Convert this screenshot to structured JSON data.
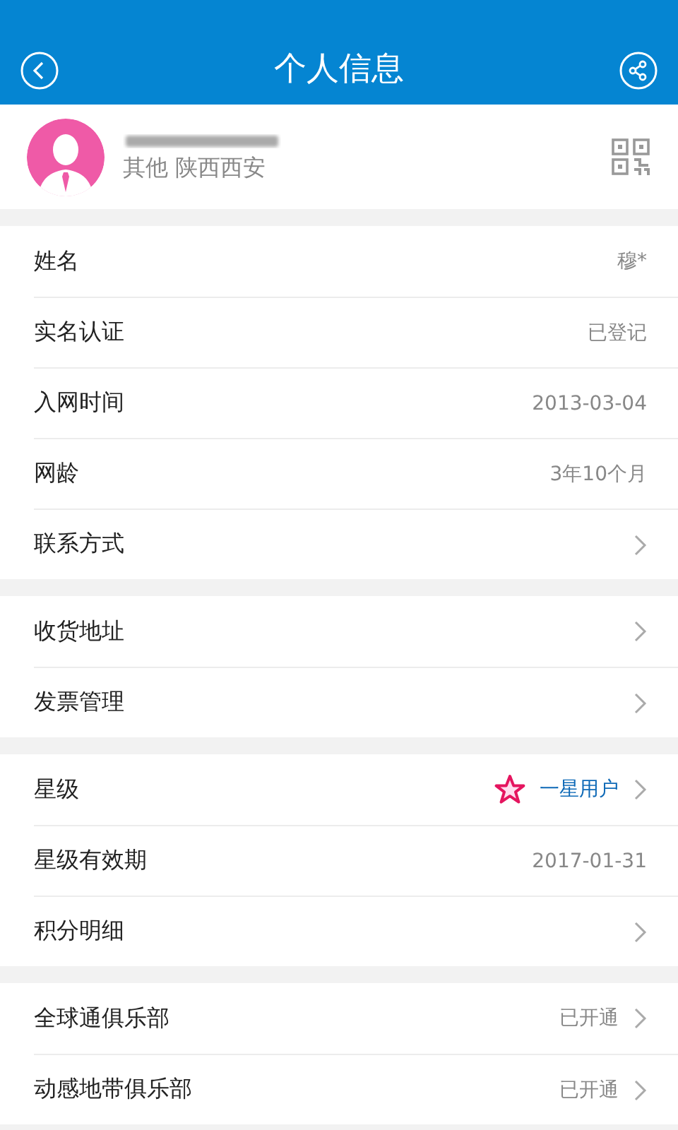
{
  "header": {
    "title": "个人信息"
  },
  "profile": {
    "location": "其他 陕西西安"
  },
  "sections": [
    {
      "rows": [
        {
          "label": "姓名",
          "value": "穆*",
          "kind": "info"
        },
        {
          "label": "实名认证",
          "value": "已登记",
          "kind": "info"
        },
        {
          "label": "入网时间",
          "value": "2013-03-04",
          "kind": "info"
        },
        {
          "label": "网龄",
          "value": "3年10个月",
          "kind": "info"
        },
        {
          "label": "联系方式",
          "kind": "link"
        }
      ]
    },
    {
      "rows": [
        {
          "label": "收货地址",
          "kind": "link"
        },
        {
          "label": "发票管理",
          "kind": "link"
        }
      ]
    },
    {
      "rows": [
        {
          "label": "星级",
          "value": "一星用户",
          "kind": "star"
        },
        {
          "label": "星级有效期",
          "value": "2017-01-31",
          "kind": "info"
        },
        {
          "label": "积分明细",
          "kind": "link"
        }
      ]
    },
    {
      "rows": [
        {
          "label": "全球通俱乐部",
          "value": "已开通",
          "kind": "link"
        },
        {
          "label": "动感地带俱乐部",
          "value": "已开通",
          "kind": "link"
        }
      ]
    }
  ]
}
